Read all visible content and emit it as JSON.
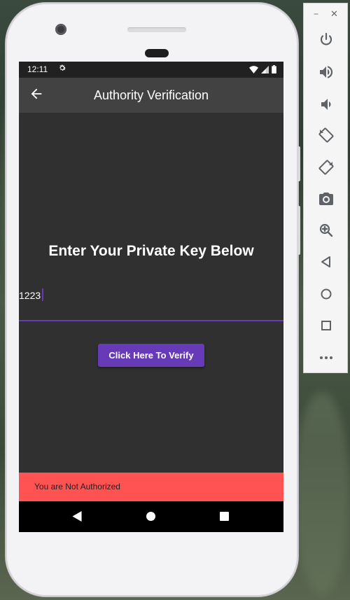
{
  "status_bar": {
    "time": "12:11"
  },
  "app_bar": {
    "title": "Authority Verification"
  },
  "main": {
    "heading": "Enter Your Private Key Below",
    "key_input_value": "1223",
    "verify_button_label": "Click Here To Verify"
  },
  "snackbar": {
    "message": "You are Not Authorized"
  },
  "colors": {
    "primary": "#673ab7",
    "snackbar": "#ff5252",
    "screen_background": "#303030",
    "app_bar": "#424242"
  },
  "emulator_toolbar": {
    "buttons": [
      "power-icon",
      "volume-up-icon",
      "volume-down-icon",
      "rotate-left-icon",
      "rotate-right-icon",
      "camera-icon",
      "zoom-icon",
      "back-icon",
      "home-icon",
      "overview-icon",
      "more-icon"
    ]
  }
}
